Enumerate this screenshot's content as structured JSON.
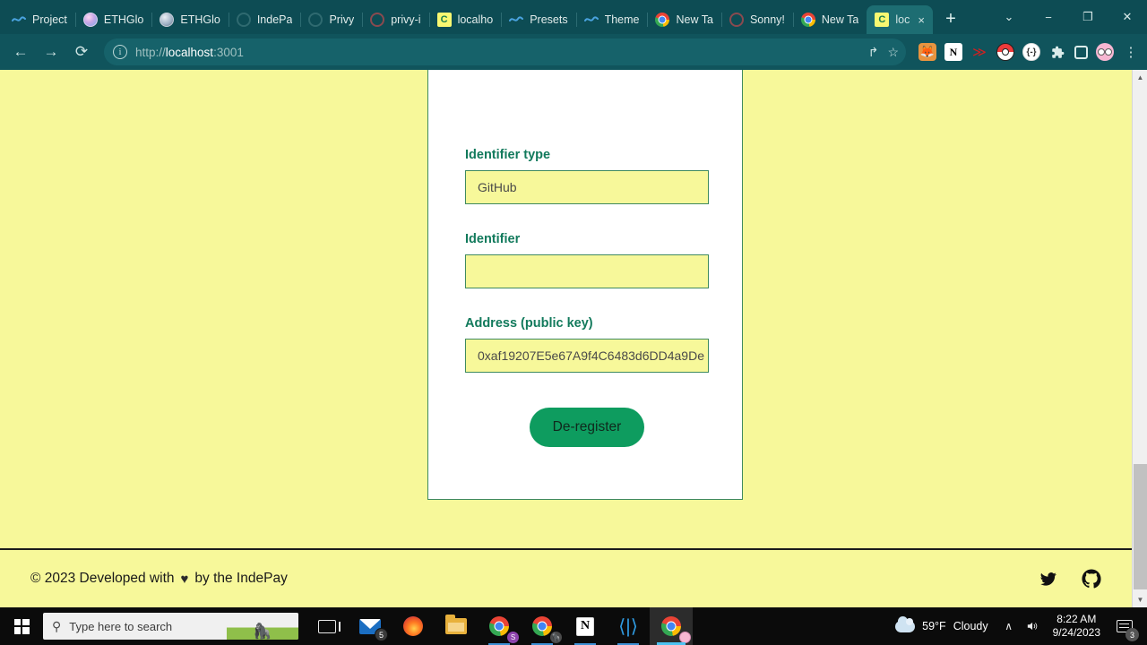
{
  "browser": {
    "tabs": [
      {
        "label": "Project",
        "icon": "swirl-icon",
        "active": false
      },
      {
        "label": "ETHGlo",
        "icon": "ethglobal-pink-icon",
        "active": false
      },
      {
        "label": "ETHGlo",
        "icon": "ethglobal-gray-icon",
        "active": false
      },
      {
        "label": "IndePa",
        "icon": "ring-icon",
        "active": false
      },
      {
        "label": "Privy",
        "icon": "ring-icon",
        "active": false
      },
      {
        "label": "privy-i",
        "icon": "github-dark-icon",
        "active": false
      },
      {
        "label": "localho",
        "icon": "localhost-c-icon",
        "active": false
      },
      {
        "label": "Presets",
        "icon": "swirl-icon",
        "active": false
      },
      {
        "label": "Theme",
        "icon": "swirl-icon",
        "active": false
      },
      {
        "label": "New Ta",
        "icon": "chrome-icon",
        "active": false
      },
      {
        "label": "Sonny!",
        "icon": "facebook-icon",
        "active": false
      },
      {
        "label": "New Ta",
        "icon": "chrome-icon",
        "active": false
      },
      {
        "label": "loc",
        "icon": "localhost-c-icon",
        "active": true
      }
    ],
    "localhost_favicon_letter": "C",
    "new_tab_label": "+",
    "tab_close_label": "×",
    "window_controls": {
      "expand": "⌄",
      "minimize": "−",
      "restore": "❐",
      "close": "✕"
    },
    "toolbar": {
      "back": "←",
      "forward": "→",
      "reload": "⟳",
      "info_icon": "i",
      "url_scheme": "http://",
      "url_host": "localhost",
      "url_port": ":3001",
      "share_icon": "↱",
      "bookmark_icon": "☆",
      "extensions": [
        {
          "name": "metamask-extension-icon",
          "glyph": "🦊"
        },
        {
          "name": "notion-extension-icon",
          "glyph": "N"
        },
        {
          "name": "red-extension-icon",
          "glyph": "≫"
        },
        {
          "name": "pokeball-extension-icon",
          "glyph": ""
        },
        {
          "name": "brackets-extension-icon",
          "glyph": "{-}"
        },
        {
          "name": "puzzle-extensions-icon",
          "glyph": "🧩"
        },
        {
          "name": "side-panel-icon",
          "glyph": ""
        },
        {
          "name": "profile-avatar-icon",
          "glyph": ""
        },
        {
          "name": "chrome-menu-icon",
          "glyph": "⋮"
        }
      ]
    }
  },
  "page": {
    "form": {
      "fields": [
        {
          "label": "Identifier type",
          "value": "GitHub",
          "placeholder": ""
        },
        {
          "label": "Identifier",
          "value": "",
          "placeholder": ""
        },
        {
          "label": "Address (public key)",
          "value": "0xaf19207E5e67A9f4C6483d6DD4a9De",
          "placeholder": ""
        }
      ],
      "submit_label": "De-register"
    },
    "footer": {
      "copyright_prefix": "© 2023 Developed with",
      "heart": "♥",
      "copyright_suffix": "by the IndePay",
      "socials": [
        {
          "name": "twitter-icon"
        },
        {
          "name": "github-icon"
        }
      ]
    },
    "colors": {
      "background": "#f7f89a",
      "card_background": "#ffffff",
      "border_green": "#3f8a5f",
      "label_green": "#127a5c",
      "button_green": "#0e9c5f"
    }
  },
  "taskbar": {
    "search_placeholder": "Type here to search",
    "items": [
      {
        "name": "task-view",
        "label": ""
      },
      {
        "name": "mail",
        "label": "",
        "badge": "5"
      },
      {
        "name": "firefox",
        "label": ""
      },
      {
        "name": "file-explorer",
        "label": ""
      },
      {
        "name": "chrome-purple",
        "label": "",
        "badge": ""
      },
      {
        "name": "chrome-gorilla",
        "label": ""
      },
      {
        "name": "notion",
        "label": "N"
      },
      {
        "name": "vscode",
        "label": ""
      },
      {
        "name": "chrome-active",
        "label": ""
      }
    ],
    "tray": {
      "weather_temp": "59°F",
      "weather_condition": "Cloudy",
      "chevron": "∧",
      "volume": "🔊",
      "time": "8:22 AM",
      "date": "9/24/2023",
      "notification_count": "3"
    }
  }
}
